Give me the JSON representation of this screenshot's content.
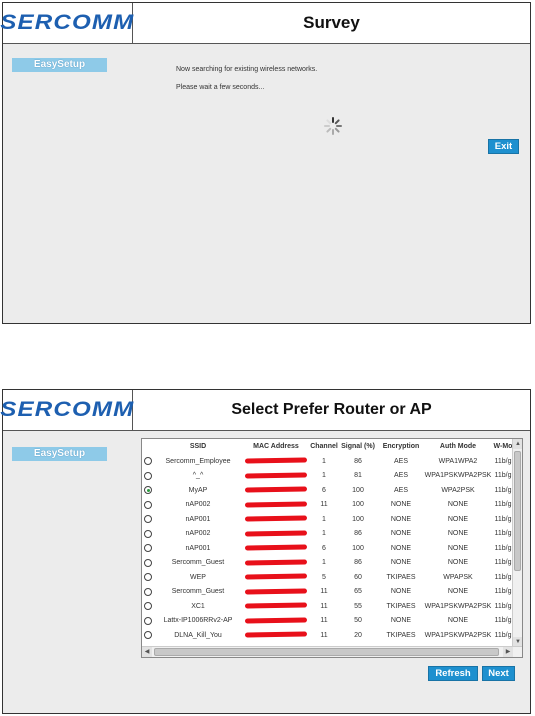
{
  "brand": "SERCOMM",
  "survey": {
    "title": "Survey",
    "sidebar_label": "EasySetup",
    "message_line1": "Now searching for existing wireless networks.",
    "message_line2": "Please wait a few seconds...",
    "exit_label": "Exit"
  },
  "select": {
    "title": "Select Prefer Router or AP",
    "sidebar_label": "EasySetup",
    "columns": [
      "SSID",
      "MAC Address",
      "Channel",
      "Signal (%)",
      "Encryption",
      "Auth Mode",
      "W-Mo"
    ],
    "rows": [
      {
        "ssid": "Sercomm_Employee",
        "channel": "1",
        "signal": "86",
        "encryption": "AES",
        "auth": "WPA1WPA2",
        "mode": "11b/g",
        "selected": false
      },
      {
        "ssid": "^_^",
        "channel": "1",
        "signal": "81",
        "encryption": "AES",
        "auth": "WPA1PSKWPA2PSK",
        "mode": "11b/g",
        "selected": false
      },
      {
        "ssid": "MyAP",
        "channel": "6",
        "signal": "100",
        "encryption": "AES",
        "auth": "WPA2PSK",
        "mode": "11b/g",
        "selected": true
      },
      {
        "ssid": "nAP002",
        "channel": "11",
        "signal": "100",
        "encryption": "NONE",
        "auth": "NONE",
        "mode": "11b/g",
        "selected": false
      },
      {
        "ssid": "nAP001",
        "channel": "1",
        "signal": "100",
        "encryption": "NONE",
        "auth": "NONE",
        "mode": "11b/g",
        "selected": false
      },
      {
        "ssid": "nAP002",
        "channel": "1",
        "signal": "86",
        "encryption": "NONE",
        "auth": "NONE",
        "mode": "11b/g",
        "selected": false
      },
      {
        "ssid": "nAP001",
        "channel": "6",
        "signal": "100",
        "encryption": "NONE",
        "auth": "NONE",
        "mode": "11b/g",
        "selected": false
      },
      {
        "ssid": "Sercomm_Guest",
        "channel": "1",
        "signal": "86",
        "encryption": "NONE",
        "auth": "NONE",
        "mode": "11b/g",
        "selected": false
      },
      {
        "ssid": "WEP",
        "channel": "5",
        "signal": "60",
        "encryption": "TKIPAES",
        "auth": "WPAPSK",
        "mode": "11b/g",
        "selected": false
      },
      {
        "ssid": "Sercomm_Guest",
        "channel": "11",
        "signal": "65",
        "encryption": "NONE",
        "auth": "NONE",
        "mode": "11b/g",
        "selected": false
      },
      {
        "ssid": "XC1",
        "channel": "11",
        "signal": "55",
        "encryption": "TKIPAES",
        "auth": "WPA1PSKWPA2PSK",
        "mode": "11b/g",
        "selected": false
      },
      {
        "ssid": "Lattx-IP1006RRv2-AP",
        "channel": "11",
        "signal": "50",
        "encryption": "NONE",
        "auth": "NONE",
        "mode": "11b/g",
        "selected": false
      },
      {
        "ssid": "DLNA_Kill_You",
        "channel": "11",
        "signal": "20",
        "encryption": "TKIPAES",
        "auth": "WPA1PSKWPA2PSK",
        "mode": "11b/g",
        "selected": false
      }
    ],
    "refresh_label": "Refresh",
    "next_label": "Next"
  },
  "colors": {
    "brand_blue": "#1d5fb0",
    "button_blue": "#1e90cf",
    "sidebar_blue": "#8ecae8",
    "redaction_red": "#e8101a"
  },
  "icons": [
    "loading-spinner-icon",
    "radio-button",
    "scroll-arrow-icon"
  ]
}
